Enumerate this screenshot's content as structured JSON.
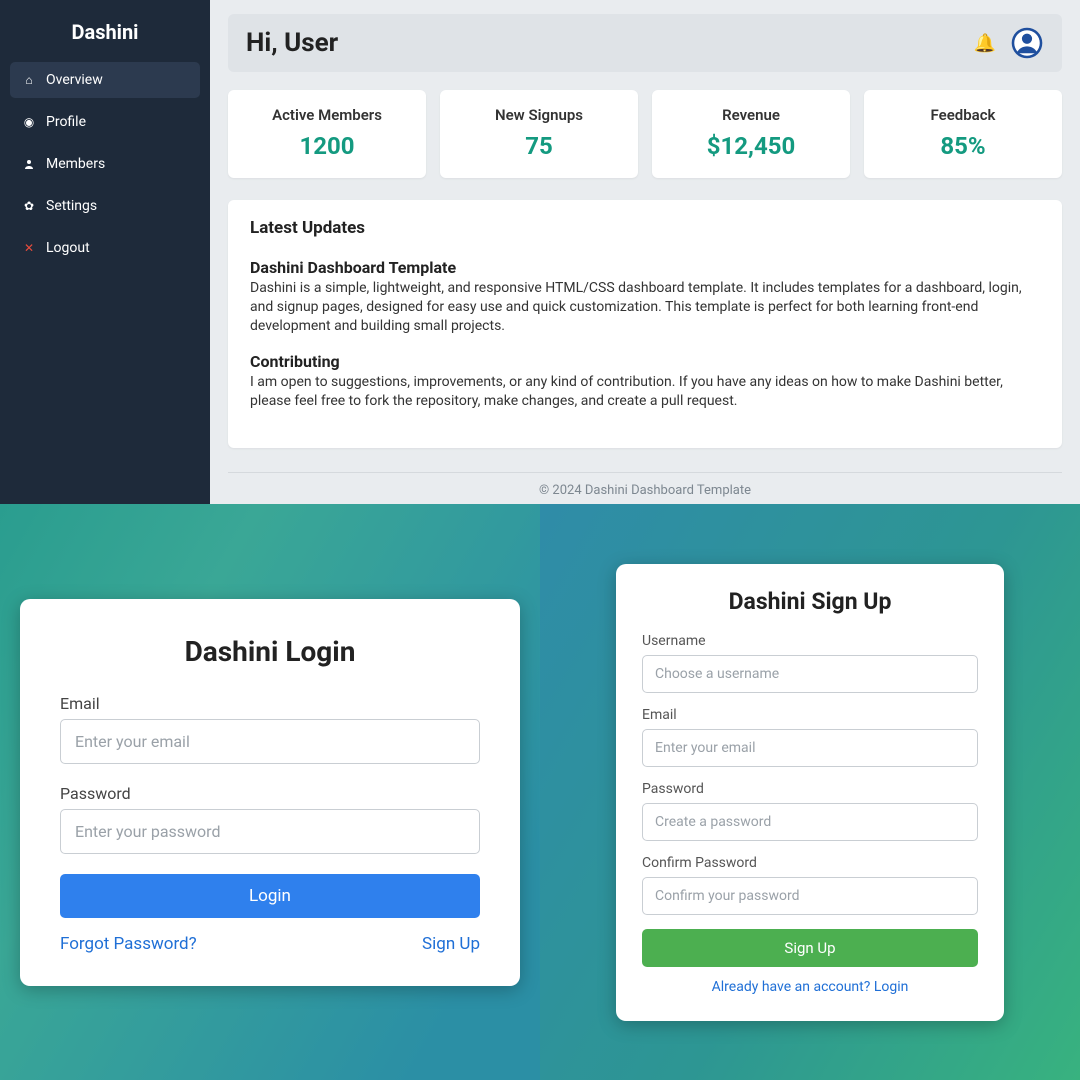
{
  "sidebar": {
    "brand": "Dashini",
    "items": [
      {
        "label": "Overview"
      },
      {
        "label": "Profile"
      },
      {
        "label": "Members"
      },
      {
        "label": "Settings"
      },
      {
        "label": "Logout"
      }
    ]
  },
  "header": {
    "greeting": "Hi, User"
  },
  "cards": [
    {
      "title": "Active Members",
      "value": "1200"
    },
    {
      "title": "New Signups",
      "value": "75"
    },
    {
      "title": "Revenue",
      "value": "$12,450"
    },
    {
      "title": "Feedback",
      "value": "85%"
    }
  ],
  "updates": {
    "title": "Latest Updates",
    "sections": [
      {
        "heading": "Dashini Dashboard Template",
        "body": "Dashini is a simple, lightweight, and responsive HTML/CSS dashboard template. It includes templates for a dashboard, login, and signup pages, designed for easy use and quick customization. This template is perfect for both learning front-end development and building small projects."
      },
      {
        "heading": "Contributing",
        "body": "I am open to suggestions, improvements, or any kind of contribution. If you have any ideas on how to make Dashini better, please feel free to fork the repository, make changes, and create a pull request."
      }
    ]
  },
  "footer": "© 2024 Dashini Dashboard Template",
  "login": {
    "title": "Dashini Login",
    "email_label": "Email",
    "email_placeholder": "Enter your email",
    "password_label": "Password",
    "password_placeholder": "Enter your password",
    "button": "Login",
    "forgot": "Forgot Password?",
    "signup": "Sign Up"
  },
  "signup": {
    "title": "Dashini Sign Up",
    "username_label": "Username",
    "username_placeholder": "Choose a username",
    "email_label": "Email",
    "email_placeholder": "Enter your email",
    "password_label": "Password",
    "password_placeholder": "Create a password",
    "confirm_label": "Confirm Password",
    "confirm_placeholder": "Confirm your password",
    "button": "Sign Up",
    "login_link": "Already have an account? Login"
  }
}
